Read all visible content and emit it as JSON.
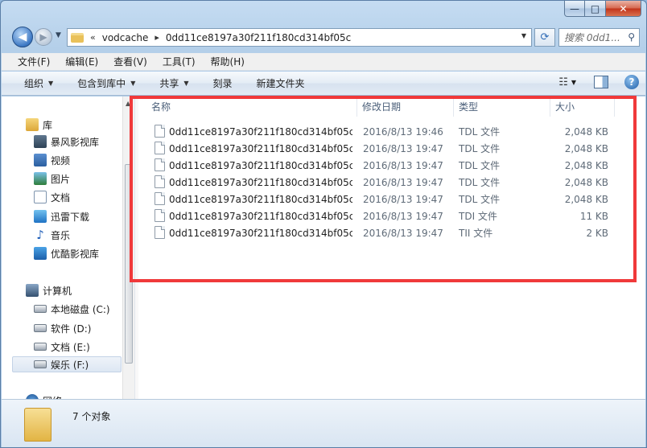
{
  "window": {
    "caption": {
      "minimize": "—",
      "maximize": "□",
      "close": "✕"
    }
  },
  "nav": {
    "back_glyph": "◀",
    "forward_glyph": "▶",
    "address": {
      "separator": "«",
      "path": "vodcache",
      "crumb_arrow": "▸",
      "folder": "0dd11ce8197a30f211f180cd314bf05c"
    },
    "search_placeholder": "搜索 0dd1..."
  },
  "menubar": [
    "文件(F)",
    "编辑(E)",
    "查看(V)",
    "工具(T)",
    "帮助(H)"
  ],
  "toolbar": {
    "organize": "组织",
    "include": "包含到库中",
    "share": "共享",
    "burn": "刻录",
    "new_folder": "新建文件夹",
    "help": "?"
  },
  "sidebar": {
    "libraries": "库",
    "lib_items": [
      "暴风影视库",
      "视频",
      "图片",
      "文档",
      "迅雷下载",
      "音乐",
      "优酷影视库"
    ],
    "computer": "计算机",
    "drives": [
      "本地磁盘 (C:)",
      "软件 (D:)",
      "文档 (E:)",
      "娱乐 (F:)"
    ],
    "network": "网络"
  },
  "columns": {
    "name": "名称",
    "date": "修改日期",
    "type": "类型",
    "size": "大小"
  },
  "files": [
    {
      "name": "0dd11ce8197a30f211f180cd314bf05c...",
      "date": "2016/8/13 19:46",
      "type": "TDL 文件",
      "size": "2,048 KB"
    },
    {
      "name": "0dd11ce8197a30f211f180cd314bf05c...",
      "date": "2016/8/13 19:47",
      "type": "TDL 文件",
      "size": "2,048 KB"
    },
    {
      "name": "0dd11ce8197a30f211f180cd314bf05c...",
      "date": "2016/8/13 19:47",
      "type": "TDL 文件",
      "size": "2,048 KB"
    },
    {
      "name": "0dd11ce8197a30f211f180cd314bf05c...",
      "date": "2016/8/13 19:47",
      "type": "TDL 文件",
      "size": "2,048 KB"
    },
    {
      "name": "0dd11ce8197a30f211f180cd314bf05c...",
      "date": "2016/8/13 19:47",
      "type": "TDL 文件",
      "size": "2,048 KB"
    },
    {
      "name": "0dd11ce8197a30f211f180cd314bf05c...",
      "date": "2016/8/13 19:47",
      "type": "TDI 文件",
      "size": "11 KB"
    },
    {
      "name": "0dd11ce8197a30f211f180cd314bf05c...",
      "date": "2016/8/13 19:47",
      "type": "TII 文件",
      "size": "2 KB"
    }
  ],
  "status": {
    "count": "7 个对象"
  },
  "colors": {
    "highlight_box": "#f0393a",
    "accent": "#2f6bb5"
  }
}
